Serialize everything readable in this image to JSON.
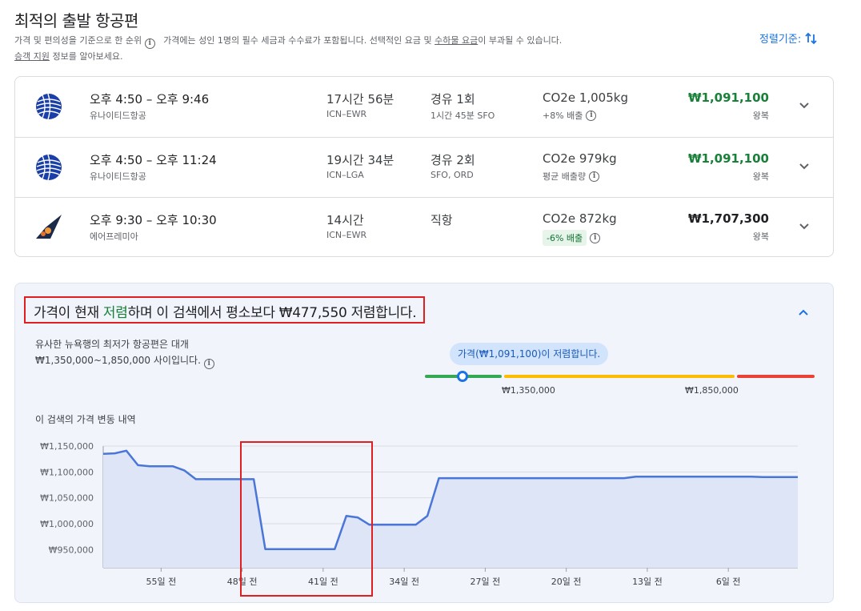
{
  "header": {
    "title": "최적의 출발 항공편",
    "subtitle_part1": "가격 및 편의성을 기준으로 한 순위",
    "subtitle_part2": "가격에는 성인 1명의 필수 세금과 수수료가 포함됩니다. 선택적인 요금 및",
    "subtitle_link": "수하물 요금",
    "subtitle_part3": "이 부과될 수 있습니다.",
    "line2_link": "승객 지원",
    "line2_rest": "정보를 알아보세요.",
    "sort_label": "정렬기준:"
  },
  "flights": [
    {
      "times": "오후 4:50 – 오후 9:46",
      "airline": "유나이티드항공",
      "duration": "17시간 56분",
      "route": "ICN–EWR",
      "stops": "경유 1회",
      "stop_detail": "1시간 45분 SFO",
      "co2": "CO2e 1,005kg",
      "co2_detail": "+8% 배출",
      "price": "₩1,091,100",
      "trip_type": "왕복",
      "logo": "united-globe-icon"
    },
    {
      "times": "오후 4:50 – 오후 11:24",
      "airline": "유나이티드항공",
      "duration": "19시간 34분",
      "route": "ICN–LGA",
      "stops": "경유 2회",
      "stop_detail": "SFO, ORD",
      "co2": "CO2e 979kg",
      "co2_detail": "평균 배출량",
      "price": "₩1,091,100",
      "trip_type": "왕복",
      "logo": "united-globe-icon"
    },
    {
      "times": "오후 9:30 – 오후 10:30",
      "airline": "에어프레미아",
      "duration": "14시간",
      "route": "ICN–EWR",
      "stops": "직항",
      "stop_detail": "",
      "co2": "CO2e 872kg",
      "co2_badge": "-6% 배출",
      "price": "₩1,707,300",
      "trip_type": "왕복",
      "logo": "air-premia-tail-icon"
    }
  ],
  "insight": {
    "title_part1": "가격이 현재",
    "title_low": "저렴",
    "title_part2": "하며 이 검색에서 평소보다 ₩477,550 저렴합니다.",
    "range_line1": "유사한 뉴욕행의 최저가 항공편은 대개",
    "range_line2": "₩1,350,000~1,850,000 사이입니다.",
    "tooltip": "가격(₩1,091,100)이 저렴합니다.",
    "range_low_label": "₩1,350,000",
    "range_high_label": "₩1,850,000",
    "history_title": "이 검색의 가격 변동 내역"
  },
  "colors": {
    "accent": "#1a73e8",
    "low_price": "#188038",
    "highlight_box": "#e02020",
    "range_green": "#34a853",
    "range_yellow": "#fbbc04",
    "range_red": "#ea4335"
  },
  "chart_data": {
    "type": "line",
    "ylabel": "",
    "xlabel": "",
    "x_ticks": [
      "55일 전",
      "48일 전",
      "41일 전",
      "34일 전",
      "27일 전",
      "20일 전",
      "13일 전",
      "6일 전"
    ],
    "x_tick_values": [
      -55,
      -48,
      -41,
      -34,
      -27,
      -20,
      -13,
      -6
    ],
    "y_ticks": [
      "₩1,150,000",
      "₩1,100,000",
      "₩1,050,000",
      "₩1,000,000",
      "₩950,000"
    ],
    "y_tick_values": [
      1150000,
      1100000,
      1050000,
      1000000,
      950000
    ],
    "xlim": [
      -60,
      0
    ],
    "ylim": [
      915000,
      1150000
    ],
    "grid": true,
    "series": [
      {
        "x": [
          -60,
          -59,
          -58,
          -57,
          -56,
          -55,
          -54,
          -53,
          -52,
          -51,
          -50,
          -49,
          -48,
          -47,
          -46,
          -45,
          -44,
          -43,
          -42,
          -41,
          -40,
          -39,
          -38,
          -37,
          -36,
          -35,
          -34,
          -33,
          -32,
          -31,
          -30,
          -29,
          -28,
          -27,
          -26,
          -25,
          -24,
          -23,
          -22,
          -21,
          -20,
          -19,
          -18,
          -17,
          -16,
          -15,
          -14,
          -13,
          -12,
          -11,
          -10,
          -9,
          -8,
          -7,
          -6,
          -5,
          -4,
          -3,
          -2,
          -1,
          0
        ],
        "y": [
          1135000,
          1136000,
          1141000,
          1113000,
          1111000,
          1111000,
          1111000,
          1103000,
          1086000,
          1086000,
          1086000,
          1086000,
          1086000,
          1086000,
          951000,
          951000,
          951000,
          951000,
          951000,
          951000,
          951000,
          1015000,
          1012000,
          998000,
          998000,
          998000,
          998000,
          998000,
          1015000,
          1088000,
          1088000,
          1088000,
          1088000,
          1088000,
          1088000,
          1088000,
          1088000,
          1088000,
          1088000,
          1088000,
          1088000,
          1088000,
          1088000,
          1088000,
          1088000,
          1088000,
          1091000,
          1091000,
          1091000,
          1091000,
          1091000,
          1091000,
          1091000,
          1091000,
          1091000,
          1091000,
          1091000,
          1090000,
          1090000,
          1090000,
          1090000
        ]
      }
    ]
  }
}
